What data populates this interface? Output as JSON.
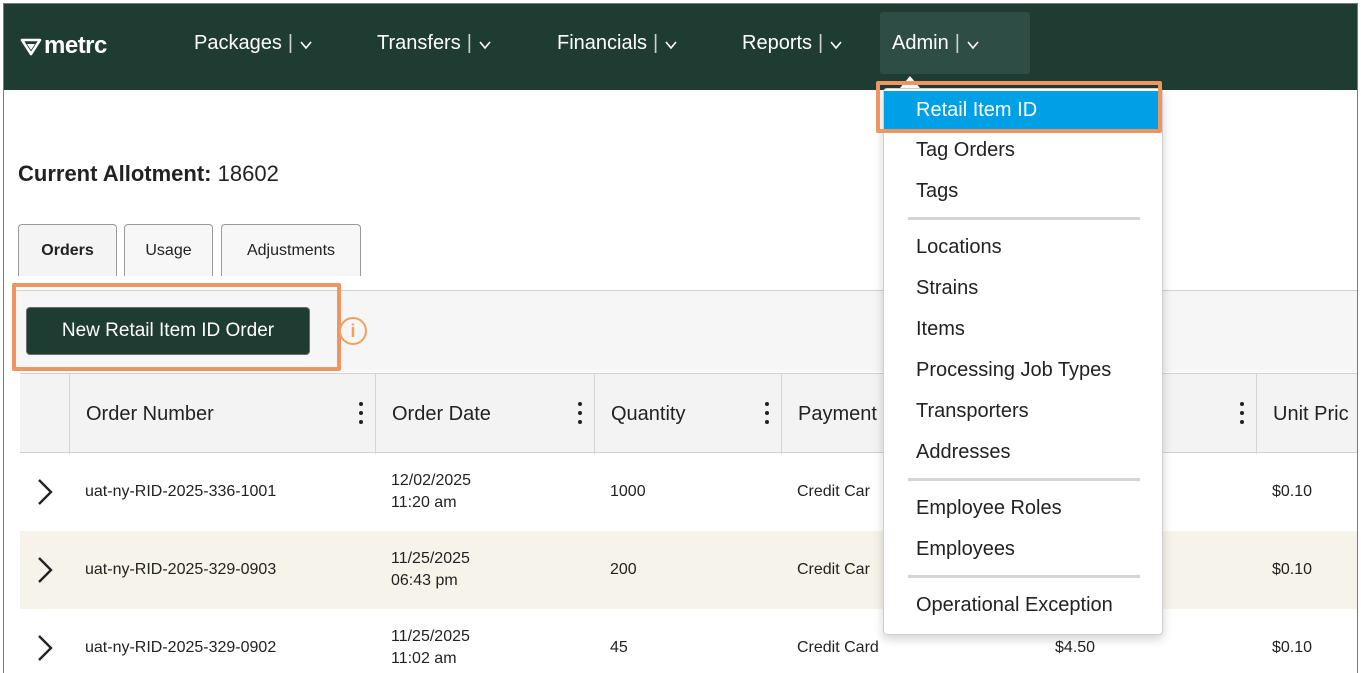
{
  "brand": {
    "logo_text": "metrc"
  },
  "nav": {
    "items": [
      {
        "label": "Packages"
      },
      {
        "label": "Transfers"
      },
      {
        "label": "Financials"
      },
      {
        "label": "Reports"
      },
      {
        "label": "Admin"
      }
    ],
    "separator": "|"
  },
  "allotment": {
    "label": "Current Allotment:",
    "value": "18602"
  },
  "tabs": [
    {
      "label": "Orders"
    },
    {
      "label": "Usage"
    },
    {
      "label": "Adjustments"
    }
  ],
  "toolbar": {
    "new_order_label": "New Retail Item ID Order",
    "info_glyph": "i"
  },
  "table": {
    "columns": [
      {
        "label": "Order Number"
      },
      {
        "label": "Order Date"
      },
      {
        "label": "Quantity"
      },
      {
        "label": "Payment"
      },
      {
        "label": ""
      },
      {
        "label": "Unit Pric"
      }
    ],
    "rows": [
      {
        "order_number": "uat-ny-RID-2025-336-1001",
        "date": "12/02/2025",
        "time": "11:20 am",
        "quantity": "1000",
        "payment": "Credit Car",
        "amount": "",
        "unit_price": "$0.10"
      },
      {
        "order_number": "uat-ny-RID-2025-329-0903",
        "date": "11/25/2025",
        "time": "06:43 pm",
        "quantity": "200",
        "payment": "Credit Car",
        "amount": "",
        "unit_price": "$0.10"
      },
      {
        "order_number": "uat-ny-RID-2025-329-0902",
        "date": "11/25/2025",
        "time": "11:02 am",
        "quantity": "45",
        "payment": "Credit Card",
        "amount": "$4.50",
        "unit_price": "$0.10"
      }
    ]
  },
  "admin_menu": {
    "items": [
      "Retail Item ID",
      "Tag Orders",
      "Tags",
      "Locations",
      "Strains",
      "Items",
      "Processing Job Types",
      "Transporters",
      "Addresses",
      "Employee Roles",
      "Employees",
      "Operational Exception"
    ],
    "selected": "Retail Item ID"
  },
  "colors": {
    "nav_bg": "#1f3c33",
    "selected_item": "#00a0e6",
    "highlight_border": "#ee9561",
    "row_alt": "#f6f3ea"
  }
}
